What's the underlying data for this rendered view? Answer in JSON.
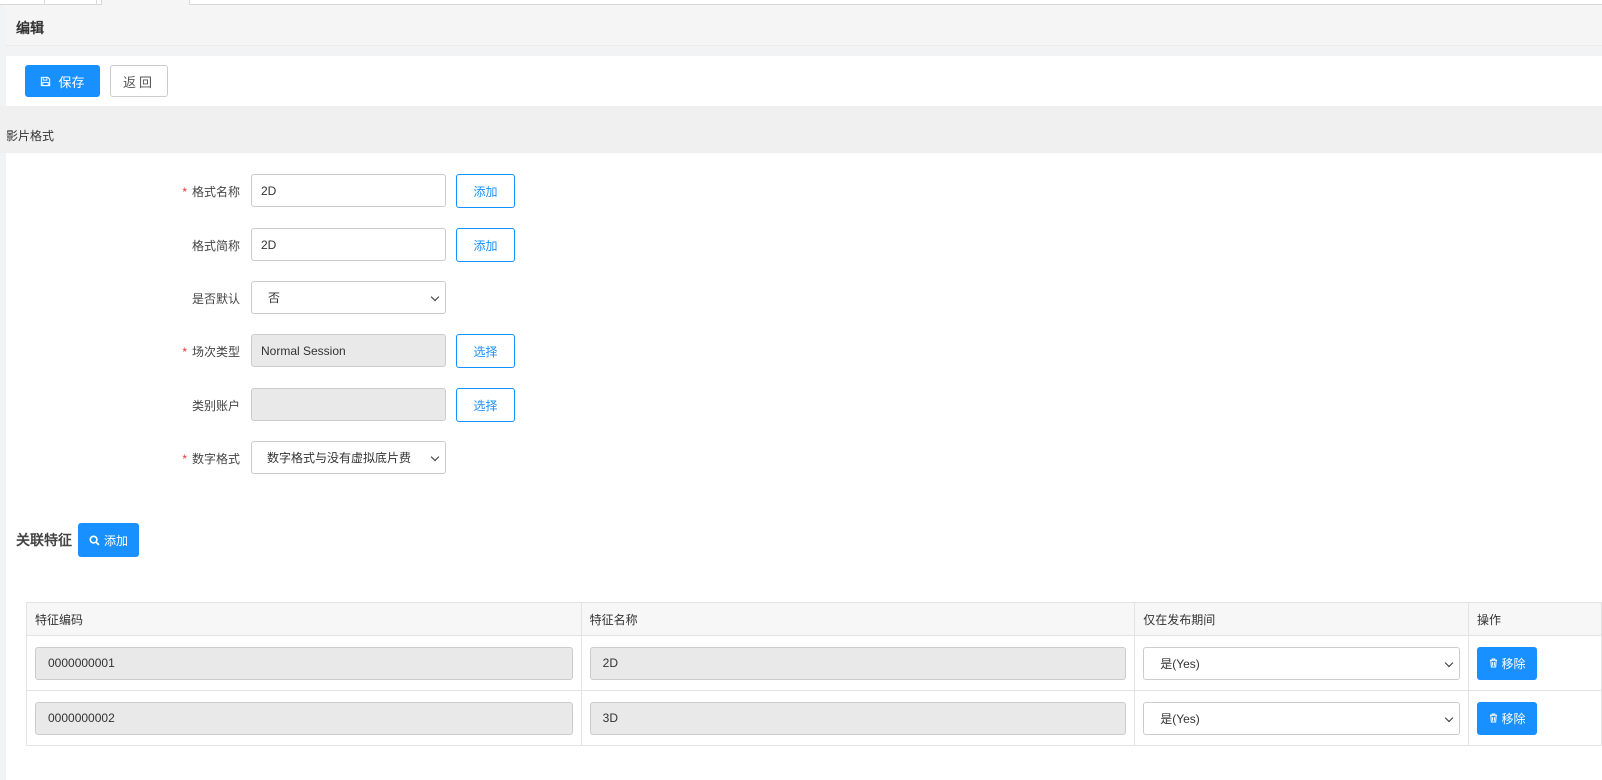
{
  "page": {
    "title": "编辑"
  },
  "toolbar": {
    "save_label": "保存",
    "back_label": "返回"
  },
  "section": {
    "title": "影片格式"
  },
  "form": {
    "format_name": {
      "label": "格式名称",
      "value": "2D",
      "button": "添加",
      "required": true
    },
    "format_short": {
      "label": "格式简称",
      "value": "2D",
      "button": "添加",
      "required": false
    },
    "is_default": {
      "label": "是否默认",
      "value": "否",
      "required": false
    },
    "session_type": {
      "label": "场次类型",
      "value": "Normal Session",
      "button": "选择",
      "required": true
    },
    "category_account": {
      "label": "类别账户",
      "value": "",
      "button": "选择",
      "required": false
    },
    "digital_format": {
      "label": "数字格式",
      "value": "数字格式与没有虚拟底片费",
      "required": true
    }
  },
  "features": {
    "title": "关联特征",
    "add_label": "添加",
    "columns": [
      "特征编码",
      "特征名称",
      "仅在发布期间",
      "操作"
    ],
    "rows": [
      {
        "code": "0000000001",
        "name": "2D",
        "release_only": "是(Yes)",
        "action": "移除"
      },
      {
        "code": "0000000002",
        "name": "3D",
        "release_only": "是(Yes)",
        "action": "移除"
      }
    ]
  },
  "colors": {
    "primary": "#1890ff",
    "required": "#e4393c"
  }
}
